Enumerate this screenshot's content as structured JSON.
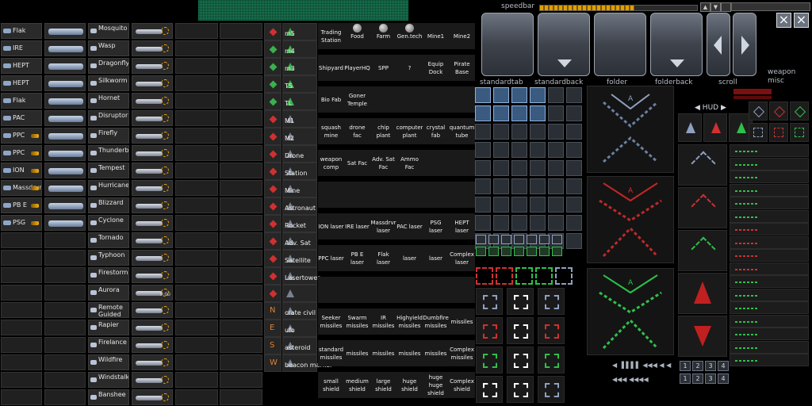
{
  "weapons": {
    "guns": [
      "Flak",
      "IRE",
      "HEPT",
      "HEPT",
      "Flak",
      "PAC",
      "PPC",
      "PPC",
      "ION",
      "Massdrvr",
      "PB E",
      "PSG"
    ],
    "missiles": [
      "Mosquito",
      "Wasp",
      "Dragonfly",
      "Silkworm",
      "Hornet",
      "Disruptor",
      "Firefly",
      "Thunderbol",
      "Tempest",
      "Hurricane",
      "Blizzard",
      "Cyclone",
      "Tornado",
      "Typhoon",
      "Firestorm",
      "Aurora",
      "Remote Guided",
      "Rapier",
      "Firelance",
      "Wildfire",
      "Windstalker",
      "Banshee"
    ],
    "aurora_counter": "0:00"
  },
  "ships": {
    "labels": [
      "m5",
      "m4",
      "m3",
      "TS",
      "TL",
      "M1",
      "M2",
      "Drone",
      "Station",
      "Mine",
      "Astronaut",
      "Rocket",
      "Adv. Sat",
      "Satellite",
      "Lasertower",
      "",
      "crate civil",
      "ufo",
      "asteroid",
      "beacon marker"
    ],
    "letters": [
      "N",
      "E",
      "S",
      "W"
    ]
  },
  "buildings": {
    "rows": [
      [
        "Trading Station",
        "Food",
        "Farm",
        "Gen.tech",
        "Mine1",
        "Mine2"
      ],
      [
        "Shipyard",
        "PlayerHQ",
        "SPP",
        "?",
        "Equip Dock",
        "Pirate Base"
      ],
      [
        "Bio Fab",
        "Goner Temple",
        "",
        "",
        "",
        ""
      ],
      [
        "squash mine",
        "drone fac",
        "chip plant",
        "computer plant",
        "crystal fab",
        "quantum tube"
      ],
      [
        "weapon comp",
        "Sat Fac",
        "Adv. Sat Fac",
        "Ammo Fac",
        "",
        ""
      ],
      [
        "",
        "",
        "",
        "",
        "",
        ""
      ],
      [
        "ION laser",
        "IRE laser",
        "Massdrvr laser",
        "PAC laser",
        "PSG laser",
        "HEPT laser"
      ],
      [
        "PPC laser",
        "PB E laser",
        "Flak laser",
        "laser",
        "laser",
        "Complex laser"
      ],
      [
        "",
        "",
        "",
        "",
        "",
        ""
      ],
      [
        "Seeker missiles",
        "Swarm missiles",
        "IR missiles",
        "Highyield missiles",
        "Dumbfire missiles",
        "missiles"
      ],
      [
        "standard missiles",
        "missiles",
        "missiles",
        "missiles",
        "missiles",
        "Complex missiles"
      ],
      [
        "small shield",
        "medium shield",
        "large shield",
        "huge shield",
        "huge huge shield",
        "Complex shield"
      ]
    ]
  },
  "topbar": {
    "speedbar_label": "speedbar",
    "button_labels": [
      "standardtab",
      "standardback",
      "folder",
      "folderback",
      "scroll"
    ],
    "weapon_label": "weapon",
    "misc_label": "misc",
    "hud_label": "HUD",
    "close_glyph": "×"
  },
  "numbers": {
    "row1": [
      "1",
      "2",
      "3",
      "4"
    ],
    "row2": [
      "1",
      "2",
      "3",
      "4"
    ]
  },
  "colors": {
    "green": "#2ec04a",
    "red": "#d03030",
    "blue": "#8fb0d8",
    "orange": "#ffaa00"
  }
}
